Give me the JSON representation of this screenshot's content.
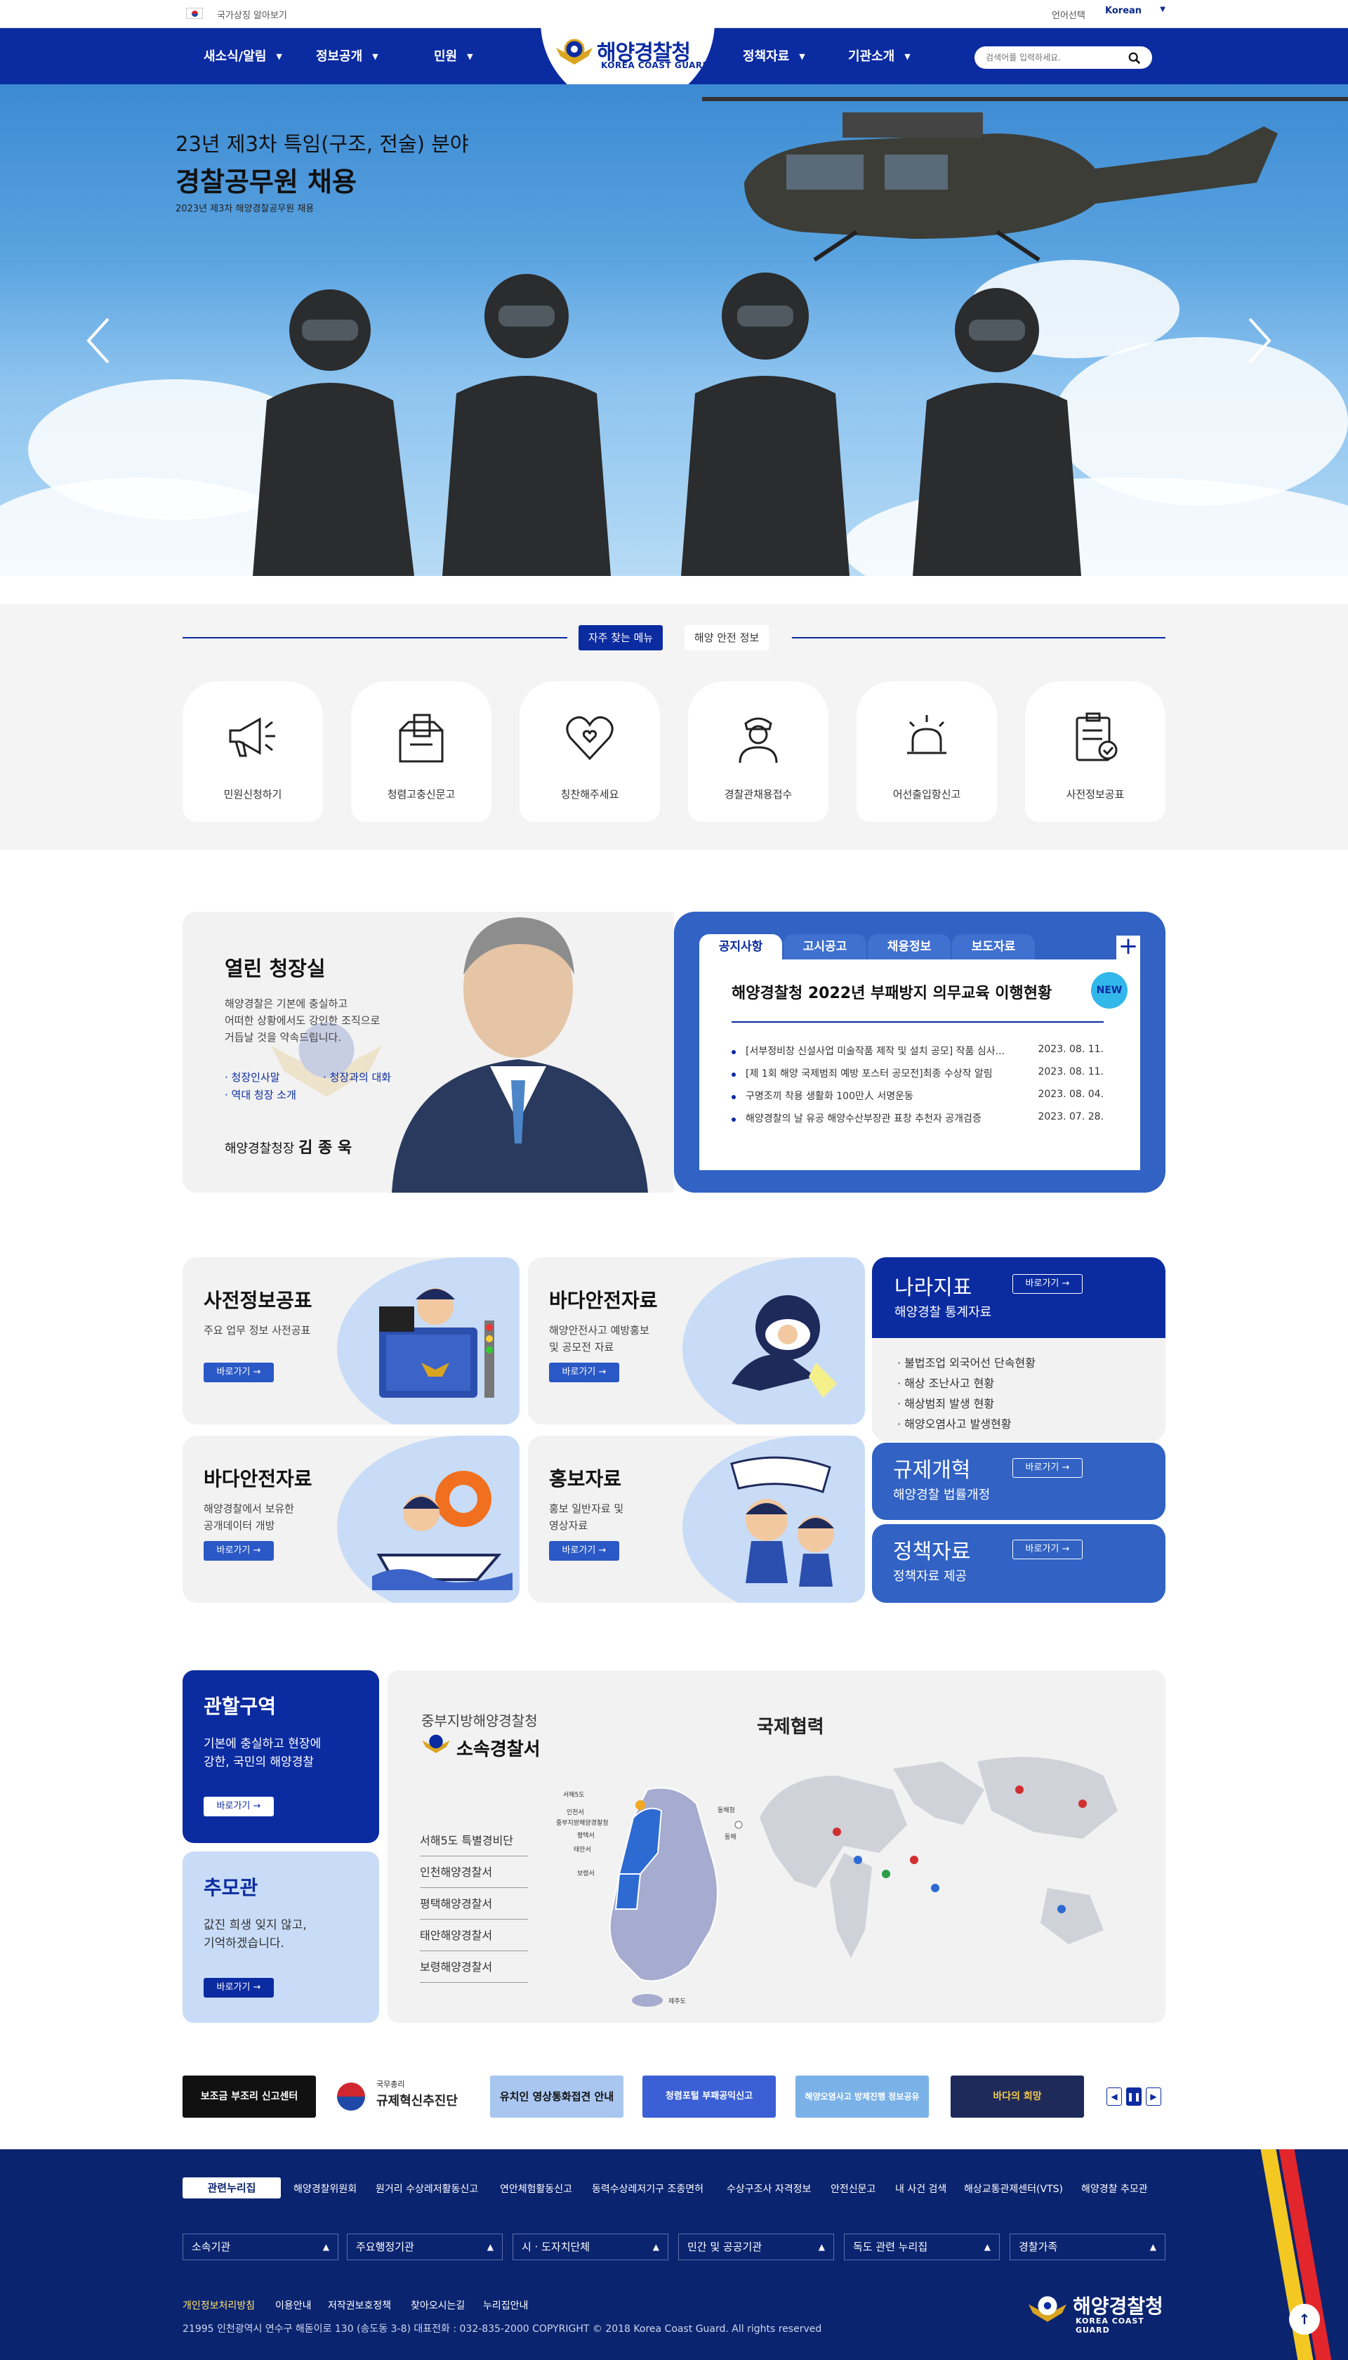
{
  "topbar": {
    "flag_text": "국가상징 알아보기",
    "lang_label": "언어선택",
    "lang_value": "Korean"
  },
  "nav": {
    "left": [
      "새소식/알림",
      "정보공개",
      "민원"
    ],
    "right": [
      "정책자료",
      "기관소개"
    ],
    "logo_kr": "해양경찰청",
    "logo_en": "KOREA COAST GUARD",
    "search_placeholder": "검색어를 입력하세요."
  },
  "hero": {
    "sub": "23년 제3차 특임(구조, 전술) 분야",
    "title": "경찰공무원 채용",
    "small": "2023년 제3차 해양경찰공무원 채용"
  },
  "quick": {
    "tab_active": "자주 찾는 메뉴",
    "tab_other": "해양 안전 정보",
    "items": [
      "민원신청하기",
      "청렴고충신문고",
      "칭찬해주세요",
      "경찰관채용접수",
      "어선출입항신고",
      "사전정보공표"
    ]
  },
  "ceo": {
    "title": "열린 청장실",
    "desc": [
      "해양경찰은 기본에 충실하고",
      "어떠한 상황에서도 강인한 조직으로",
      "거듭날 것을 약속드립니다."
    ],
    "links": [
      "· 청장인사말",
      "· 청장과의 대화",
      "· 역대 청장 소개"
    ],
    "name_prefix": "해양경찰청장",
    "name": "김 종 욱"
  },
  "notice": {
    "tabs": [
      "공지사항",
      "고시공고",
      "채용정보",
      "보도자료"
    ],
    "headline": "해양경찰청 2022년 부패방지 의무교육 이행현황",
    "badge": "NEW",
    "rows": [
      {
        "title": "[서부정비창 신설사업 미술작품 제작 및 설치 공모] 작품 심사...",
        "date": "2023. 08. 11."
      },
      {
        "title": "[제 1회 해양 국제범죄 예방 포스터 공모전]최종 수상작 알림",
        "date": "2023. 08. 11."
      },
      {
        "title": "구명조끼 착용 생활화 100만人 서명운동",
        "date": "2023. 08. 04."
      },
      {
        "title": "해양경찰의 날 유공 해양수산부장관 표창 추천자 공개검증",
        "date": "2023. 07. 28."
      }
    ]
  },
  "cards": {
    "go": "바로가기",
    "c1": {
      "title": "사전정보공표",
      "desc": [
        "주요 업무 정보 사전공표"
      ]
    },
    "c2": {
      "title": "바다안전자료",
      "desc": [
        "해양안전사고 예방홍보",
        "및 공모전 자료"
      ]
    },
    "c3": {
      "title": "바다안전자료",
      "desc": [
        "해양경찰에서 보유한",
        "공개데이터 개방"
      ]
    },
    "c4": {
      "title": "홍보자료",
      "desc": [
        "홍보 일반자료 및",
        "영상자료"
      ]
    },
    "nara": {
      "title": "나라지표",
      "sub": "해양경찰 통계자료",
      "items": [
        "· 불법조업 외국어선 단속현황",
        "· 해상 조난사고 현황",
        "· 해상범죄 발생 현황",
        "· 해양오염사고 발생현황"
      ]
    },
    "reg": {
      "title": "규제개혁",
      "sub": "해양경찰 법률개정"
    },
    "policy": {
      "title": "정책자료",
      "sub": "정책자료 제공"
    }
  },
  "juris": {
    "title": "관할구역",
    "desc": [
      "기본에 충실하고 현장에",
      "강한, 국민의 해양경찰"
    ]
  },
  "memorial": {
    "title": "추모관",
    "desc": [
      "값진 희생 잊지 않고,",
      "기억하겠습니다."
    ]
  },
  "map": {
    "region": "중부지방해양경찰청",
    "subtitle": "소속경찰서",
    "stations": [
      "서해5도 특별경비단",
      "인천해양경찰서",
      "평택해양경찰서",
      "태안해양경찰서",
      "보령해양경찰서"
    ],
    "intl": "국제협력",
    "map_labels": [
      "서해5도",
      "인천서",
      "중부지방해양경찰청",
      "평택서",
      "태안서",
      "보령서",
      "동해청",
      "동해",
      "제주도"
    ]
  },
  "banners": [
    "보조금 부조리 신고센터",
    "규제혁신추진단",
    "유치인 영상통화접견 안내",
    "청렴포털 부패공익신고",
    "해양오염사고 방제진행 정보공유",
    "바다의 희망"
  ],
  "banner_small": {
    "gov": "국무총리"
  },
  "footer": {
    "rel_label": "관련누리집",
    "rel_links": [
      "해양경찰위원회",
      "원거리 수상레저활동신고",
      "연안체험활동신고",
      "동력수상레저기구 조종면허",
      "수상구조사 자격정보",
      "안전신문고",
      "내 사건 검색",
      "해상교통관제센터(VTS)",
      "해양경찰 추모관"
    ],
    "selects": [
      "소속기관",
      "주요행정기관",
      "시 · 도자치단체",
      "민간 및 공공기관",
      "독도 관련 누리집",
      "경찰가족"
    ],
    "links": [
      "개인정보처리방침",
      "이용안내",
      "저작권보호정책",
      "찾아오시는길",
      "누리집안내"
    ],
    "copyright": "21995 인천광역시 연수구 해돋이로 130 (송도동 3-8) 대표전화 : 032-835-2000 COPYRIGHT © 2018 Korea Coast Guard. All rights reserved",
    "logo_kr": "해양경찰청",
    "logo_en": "KOREA COAST GUARD"
  },
  "colors": {
    "brand": "#0b2ba1",
    "accent": "#3162c4",
    "footer": "#0b2470"
  }
}
